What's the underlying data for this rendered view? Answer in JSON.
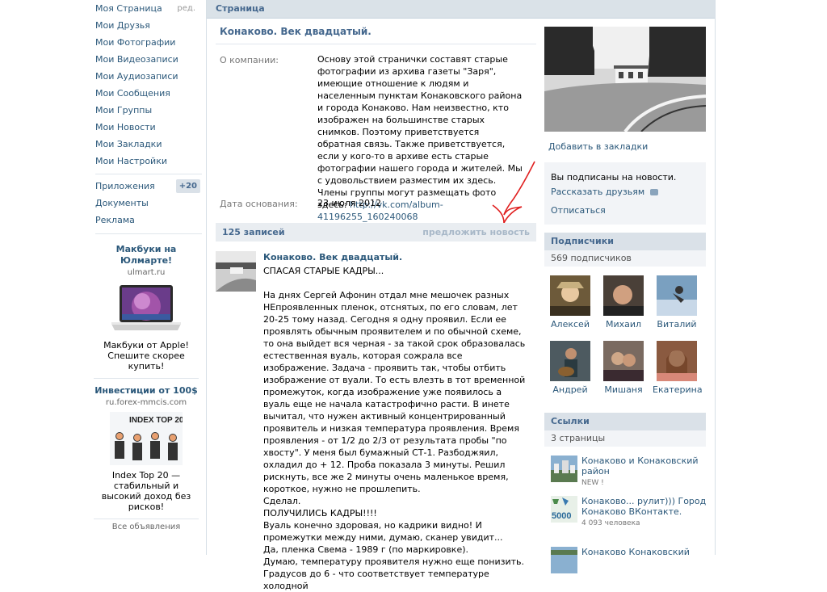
{
  "menu": {
    "items": [
      {
        "label": "Моя Страница",
        "aside": "ред."
      },
      {
        "label": "Мои Друзья"
      },
      {
        "label": "Мои Фотографии"
      },
      {
        "label": "Мои Видеозаписи"
      },
      {
        "label": "Мои Аудиозаписи"
      },
      {
        "label": "Мои Сообщения"
      },
      {
        "label": "Мои Группы"
      },
      {
        "label": "Мои Новости"
      },
      {
        "label": "Мои Закладки"
      },
      {
        "label": "Мои Настройки"
      }
    ],
    "extra": [
      {
        "label": "Приложения",
        "badge": "+20"
      },
      {
        "label": "Документы"
      },
      {
        "label": "Реклама"
      }
    ]
  },
  "ads": [
    {
      "title": "Макбуки на Юлмарте!",
      "domain": "ulmart.ru",
      "text": "Макбуки от Apple! Спешите скорее купить!",
      "icon": "laptop-image"
    },
    {
      "title": "Инвестиции от 100$",
      "domain": "ru.forex-mmcis.com",
      "text": "Index Top 20 — стабильный и высокий доход без рисков!",
      "icon": "index-top20-image",
      "image_caption": "INDEX TOP 20"
    }
  ],
  "ads_all": "Все объявления",
  "page": {
    "header": "Страница",
    "title": "Конаково. Век двадцатый.",
    "about_label": "О компании:",
    "about_text": "Основу этой странички составят старые фотографии из архива газеты \"Заря\", имеющие отношение к людям и населенным пунктам Конаковского района и города Конаково. Нам неизвестно, кто изображен на большинстве старых снимков. Поэтому приветствуется обратная связь. Также приветствуется, если у кого-то в архиве есть старые фотографии нашего города и жителей. Мы с удовольствием разместим их здесь. Члены группы могут размещать фото здесь: ",
    "about_link": "http://vk.com/album-41196255_160240068",
    "founded_label": "Дата основания:",
    "founded_value": "23 июля 2012"
  },
  "wall": {
    "count": "125 записей",
    "suggest": "предложить новость",
    "post": {
      "author": "Конаково. Век двадцатый.",
      "text": "СПАСАЯ СТАРЫЕ КАДРЫ...\n\nНа днях Сергей Афонин отдал мне мешочек разных НЕпроявленных пленок, отснятых, по его словам, лет 20-25 тому назад. Сегодня я одну проявил. Если ее проявлять обычным проявителем и по обычной схеме, то она выйдет вся черная - за такой срок образовалась естественная вуаль, которая сожрала все изображение. Задача - проявить так, чтобы отбить изображение от вуали. То есть влезть в тот временной промежуток, когда изображение уже появилось а вуаль еще не начала катастрофично расти. В инете вычитал, что нужен активный концентрированный проявитель и низкая температура проявления. Время проявления - от 1/2 до 2/3 от результата пробы \"по хвосту\". У меня был бумажный СТ-1. Разбоджяил, охладил до + 12. Проба показала 3 минуты. Решил рискнуть, все же 2 минуты очень маленькое время, короткое, нужно не прошлепить.\nСделал.\nПОЛУЧИЛИСЬ КАДРЫ!!!!\nВуаль конечно здоровая, но кадрики видно! И промежутки между ними, думаю, сканер увидит...\nДа, пленка Свема - 1989 г (по маркировке).\nДумаю, температуру проявителя нужно еще понизить.\nГрадусов до 6 - что соответствует температуре холодной"
    }
  },
  "right": {
    "bookmark": "Добавить в закладки",
    "subscribed": "Вы подписаны на новости.",
    "tell_friends": "Рассказать друзьям",
    "unsubscribe": "Отписаться",
    "subscribers_head": "Подписчики",
    "subscribers_count": "569 подписчиков",
    "members": [
      {
        "name": "Алексей",
        "color": "#6d5a3a"
      },
      {
        "name": "Михаил",
        "color": "#4a4038"
      },
      {
        "name": "Виталий",
        "color": "#7aa0c0"
      },
      {
        "name": "Андрей",
        "color": "#4d5a60"
      },
      {
        "name": "Мишаня",
        "color": "#7a6a60"
      },
      {
        "name": "Екатерина",
        "color": "#8a5a40"
      }
    ],
    "links_head": "Ссылки",
    "links_count": "3 страницы",
    "links": [
      {
        "title": "Конаково и Конаковский район",
        "sub": "NEW !"
      },
      {
        "title": "Конаково... рулит))) Город Конаково ВКонтакте.",
        "sub": "4 093 человека",
        "thumb_text": "5000"
      },
      {
        "title": "Конаково Конаковский",
        "sub": ""
      }
    ]
  },
  "colors": {
    "link": "#2b587a",
    "header_bg": "#dae2e8",
    "accent": "#45688e",
    "annotation_red": "#e02020"
  }
}
